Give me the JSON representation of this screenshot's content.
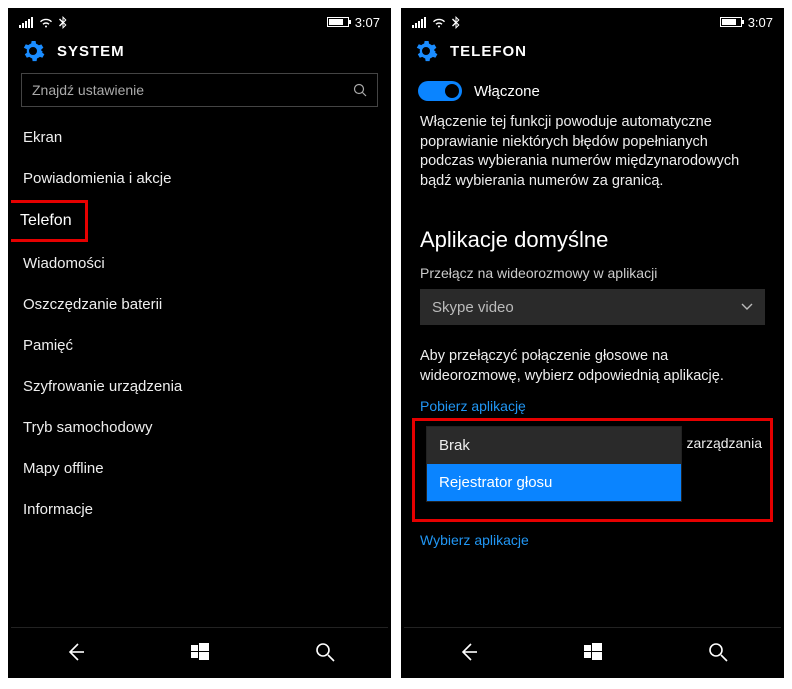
{
  "status": {
    "time": "3:07"
  },
  "left": {
    "header": "SYSTEM",
    "search_placeholder": "Znajdź ustawienie",
    "items": [
      "Ekran",
      "Powiadomienia i akcje",
      "Telefon",
      "Wiadomości",
      "Oszczędzanie baterii",
      "Pamięć",
      "Szyfrowanie urządzenia",
      "Tryb samochodowy",
      "Mapy offline",
      "Informacje"
    ],
    "highlighted_index": 2
  },
  "right": {
    "header": "TELEFON",
    "toggle": {
      "on": true,
      "label": "Włączone"
    },
    "desc": "Włączenie tej funkcji powoduje automatyczne poprawianie niektórych błędów popełnianych podczas wybierania numerów międzynarodowych bądź wybierania numerów za granicą.",
    "section_title": "Aplikacje domyślne",
    "video_label": "Przełącz na wideorozmowy w aplikacji",
    "video_selected": "Skype video",
    "body": "Aby przełączyć połączenie głosowe na wideorozmowę, wybierz odpowiednią aplikację.",
    "download_link": "Pobierz aplikację",
    "bg_text_fragment": "lo zarządzania",
    "options": [
      "Brak",
      "Rejestrator głosu"
    ],
    "selected_option_index": 1,
    "choose_link": "Wybierz aplikacje"
  }
}
